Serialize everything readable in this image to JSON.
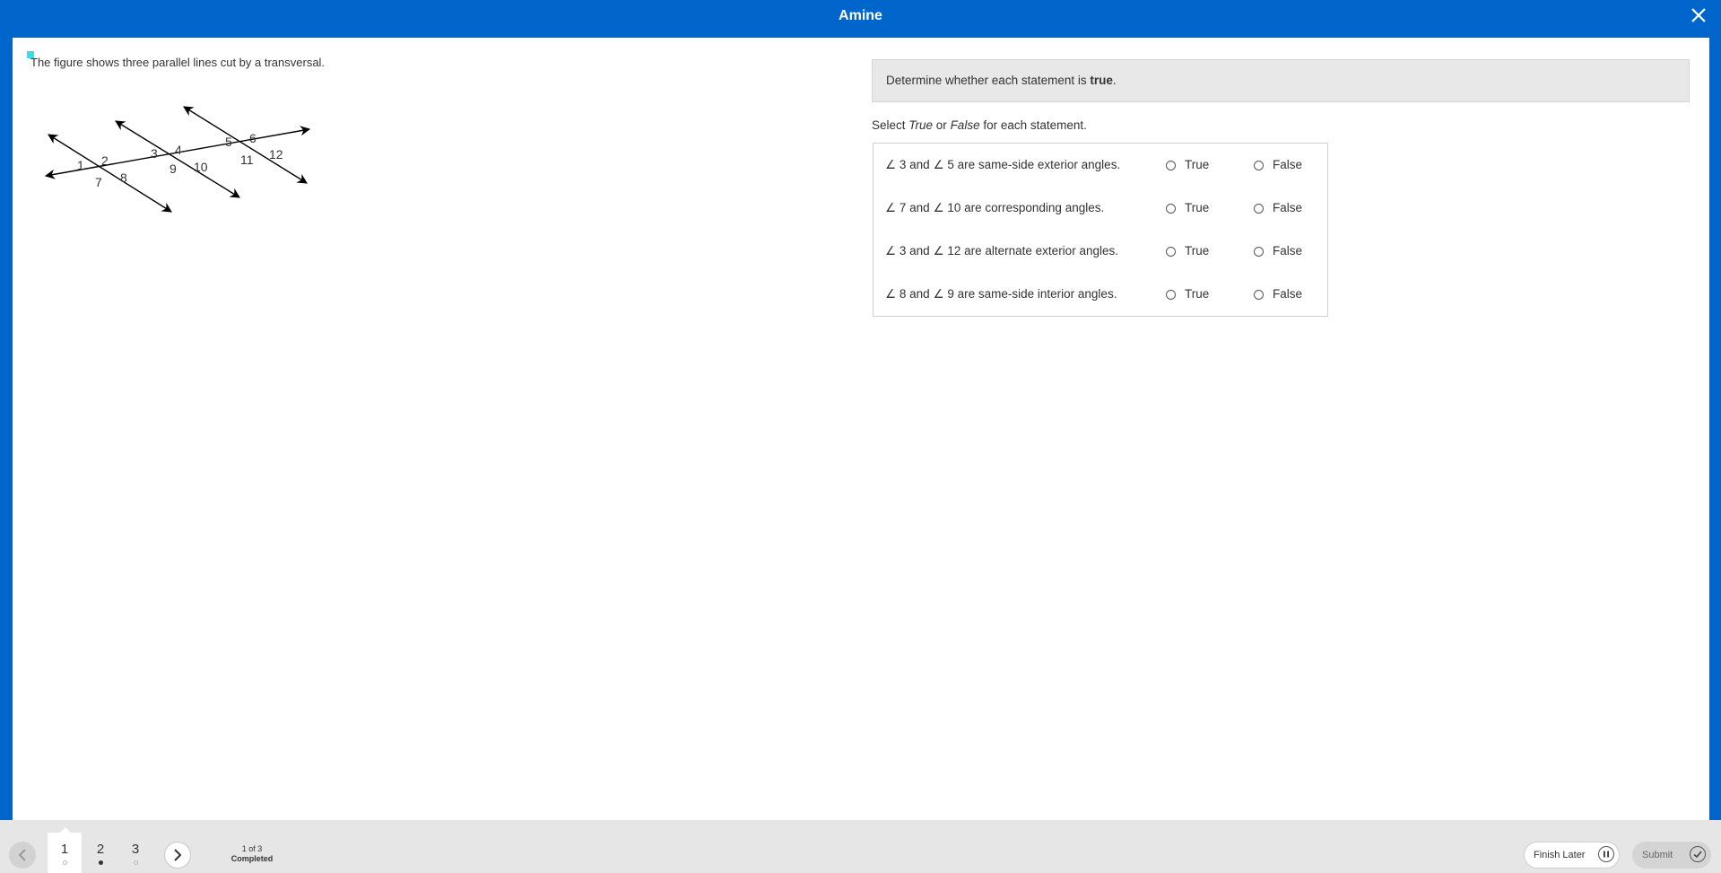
{
  "header": {
    "title": "Amine",
    "close_icon": "close-icon"
  },
  "question": {
    "prompt": "The figure shows three parallel lines cut by a transversal.",
    "figure_labels": [
      "1",
      "2",
      "3",
      "4",
      "5",
      "6",
      "7",
      "8",
      "9",
      "10",
      "11",
      "12"
    ],
    "instruction_prefix": "Determine whether each statement is ",
    "instruction_bold": "true",
    "instruction_suffix": ".",
    "select_prefix": "Select ",
    "select_true": "True",
    "select_mid": " or ",
    "select_false": "False",
    "select_suffix": " for each statement.",
    "angle_symbol": "∠",
    "statements": [
      {
        "a": "3",
        "b": "5",
        "rest": "are same-side exterior angles."
      },
      {
        "a": "7",
        "b": "10",
        "rest": "are corresponding angles."
      },
      {
        "a": "3",
        "b": "12",
        "rest": "are alternate exterior angles."
      },
      {
        "a": "8",
        "b": "9",
        "rest": "are same-side interior angles."
      }
    ],
    "and_word": "and",
    "true_label": "True",
    "false_label": "False"
  },
  "footer": {
    "tabs": [
      {
        "label": "1",
        "status": "empty"
      },
      {
        "label": "2",
        "status": "filled"
      },
      {
        "label": "3",
        "status": "empty"
      }
    ],
    "progress_count": "1 of 3",
    "progress_status": "Completed",
    "finish_later_label": "Finish Later",
    "submit_label": "Submit"
  },
  "colors": {
    "brand_blue": "#0066cc",
    "marker_cyan": "#3fd9e8"
  }
}
